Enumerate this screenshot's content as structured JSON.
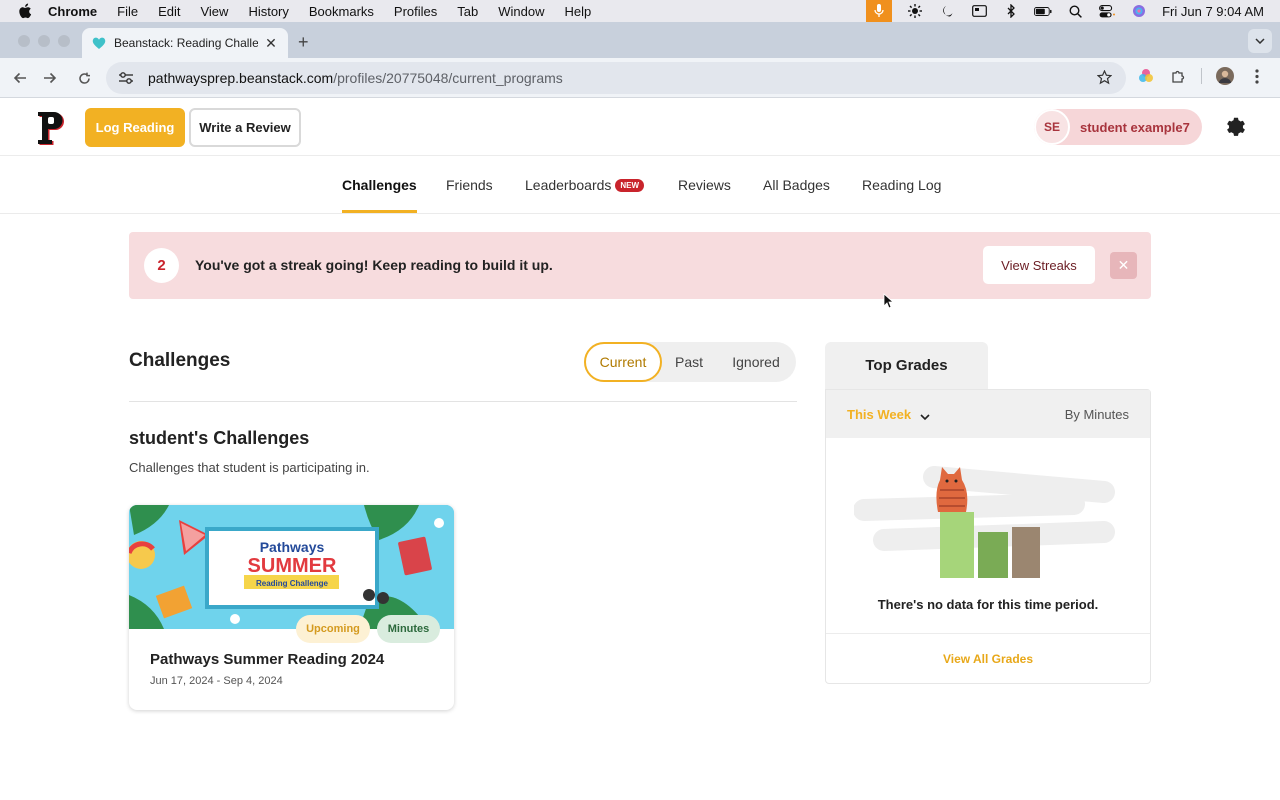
{
  "menubar": {
    "app": "Chrome",
    "items": [
      "File",
      "Edit",
      "View",
      "History",
      "Bookmarks",
      "Profiles",
      "Tab",
      "Window",
      "Help"
    ],
    "clock": "Fri Jun 7  9:04 AM"
  },
  "browser": {
    "tab_title": "Beanstack: Reading Challeng",
    "url_host": "pathwaysprep.beanstack.com",
    "url_path": "/profiles/20775048/current_programs"
  },
  "header": {
    "logo_letter": "P",
    "log_reading": "Log Reading",
    "write_review": "Write a Review",
    "user_initials": "SE",
    "user_name": "student example7"
  },
  "nav": {
    "tabs": [
      {
        "label": "Challenges"
      },
      {
        "label": "Friends"
      },
      {
        "label": "Leaderboards"
      },
      {
        "label": "Reviews"
      },
      {
        "label": "All Badges"
      },
      {
        "label": "Reading Log"
      }
    ],
    "new_badge": "NEW"
  },
  "streak": {
    "count": "2",
    "message": "You've got a streak going! Keep reading to build it up.",
    "button": "View Streaks"
  },
  "challenges": {
    "title": "Challenges",
    "filters": [
      "Current",
      "Past",
      "Ignored"
    ],
    "section_title": "student's Challenges",
    "section_desc": "Challenges that student is participating in.",
    "card": {
      "banner_line1": "Pathways",
      "banner_line2": "SUMMER",
      "banner_line3": "Reading Challenge",
      "tag_status": "Upcoming",
      "tag_type": "Minutes",
      "name": "Pathways Summer Reading 2024",
      "dates": "Jun 17, 2024 - Sep 4, 2024"
    }
  },
  "top_grades": {
    "title": "Top Grades",
    "period": "This Week",
    "metric": "By Minutes",
    "empty": "There's no data for this time period.",
    "link": "View All Grades"
  },
  "colors": {
    "accent": "#f2b123",
    "brand_red": "#c9242c",
    "banner_pink": "#f7dcde"
  }
}
